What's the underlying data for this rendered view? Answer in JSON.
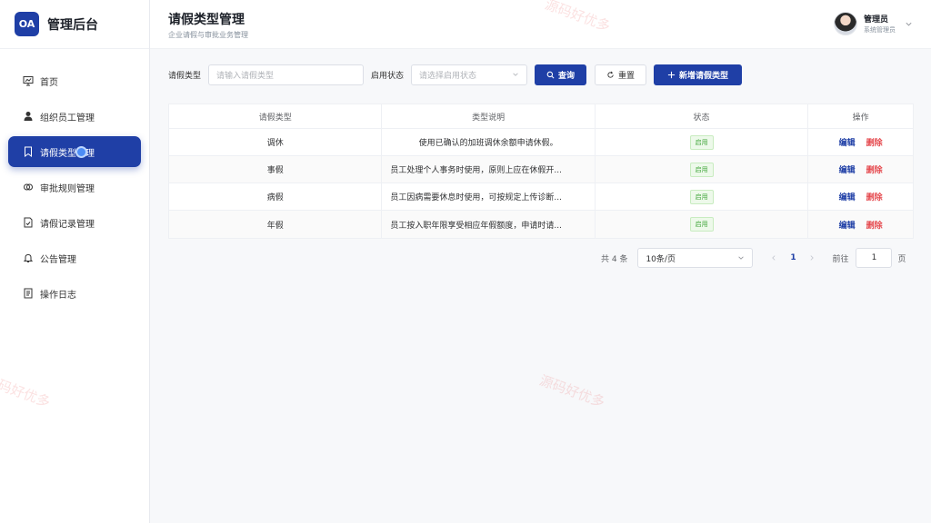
{
  "brand": {
    "logo": "OA",
    "name": "管理后台"
  },
  "sidebar": {
    "items": [
      {
        "label": "首页",
        "icon": "chart-board-icon"
      },
      {
        "label": "组织员工管理",
        "icon": "user-icon"
      },
      {
        "label": "请假类型管理",
        "icon": "bookmark-icon",
        "active": true
      },
      {
        "label": "审批规则管理",
        "icon": "rule-icon"
      },
      {
        "label": "请假记录管理",
        "icon": "document-icon"
      },
      {
        "label": "公告管理",
        "icon": "bell-icon"
      },
      {
        "label": "操作日志",
        "icon": "log-icon"
      }
    ]
  },
  "header": {
    "title": "请假类型管理",
    "subtitle": "企业请假与审批业务管理",
    "user": {
      "name": "管理员",
      "role": "系统管理员"
    }
  },
  "filters": {
    "type_label": "请假类型",
    "type_placeholder": "请输入请假类型",
    "status_label": "启用状态",
    "status_placeholder": "请选择启用状态",
    "search_button": "查询",
    "reset_button": "重置",
    "add_button": "新增请假类型"
  },
  "table": {
    "columns": [
      "请假类型",
      "类型说明",
      "状态",
      "操作"
    ],
    "rows": [
      {
        "type": "调休",
        "desc": "使用已确认的加班调休余额申请休假。",
        "status": "启用"
      },
      {
        "type": "事假",
        "desc": "员工处理个人事务时使用，原则上应在休假开...",
        "status": "启用"
      },
      {
        "type": "病假",
        "desc": "员工因病需要休息时使用，可按规定上传诊断...",
        "status": "启用"
      },
      {
        "type": "年假",
        "desc": "员工按入职年限享受相应年假额度，申请时请...",
        "status": "启用"
      }
    ],
    "edit_label": "编辑",
    "delete_label": "删除"
  },
  "pager": {
    "total_text": "共 4 条",
    "page_size": "10条/页",
    "current_page": "1",
    "goto_label": "前往",
    "goto_value": "1",
    "page_unit": "页"
  },
  "watermark": "源码好优多",
  "colors": {
    "primary": "#1f3fa6",
    "danger": "#e5484d",
    "success": "#42a63c"
  }
}
